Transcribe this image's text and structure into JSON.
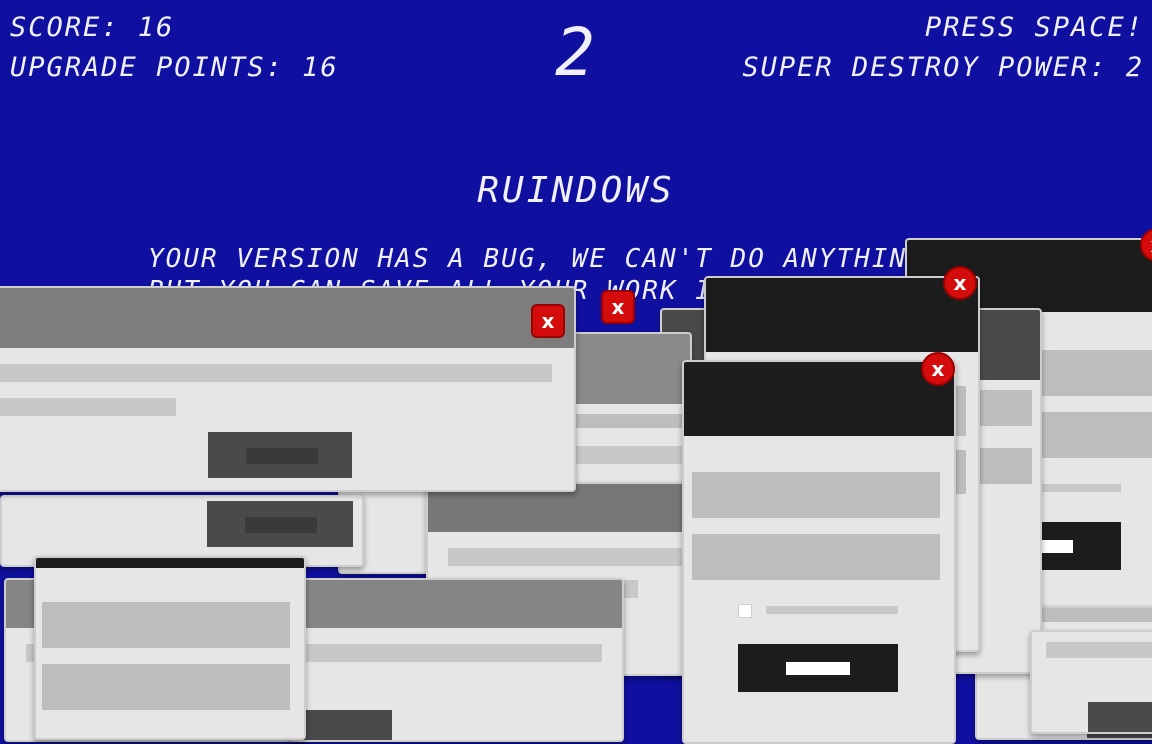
{
  "hud": {
    "score": "SCORE: 16",
    "upgrade_points": "UPGRADE POINTS: 16",
    "level": "2",
    "press_prompt": "PRESS SPACE!",
    "super_destroy_power": "SUPER DESTROY POWER: 2"
  },
  "game": {
    "title": "RUINDOWS",
    "message_line1": "YOUR VERSION HAS A BUG, WE CAN'T DO ANYTHING ABOUT IT.",
    "message_line2": "BUT YOU CAN SAVE ALL YOUR WORK IF YOU CLO"
  },
  "popups": {
    "close_glyph": "x"
  },
  "colors": {
    "background": "#1010a0",
    "close_button": "#d40c0c",
    "hud_text": "#f0f0ff"
  },
  "icons": [
    "close-icon"
  ]
}
